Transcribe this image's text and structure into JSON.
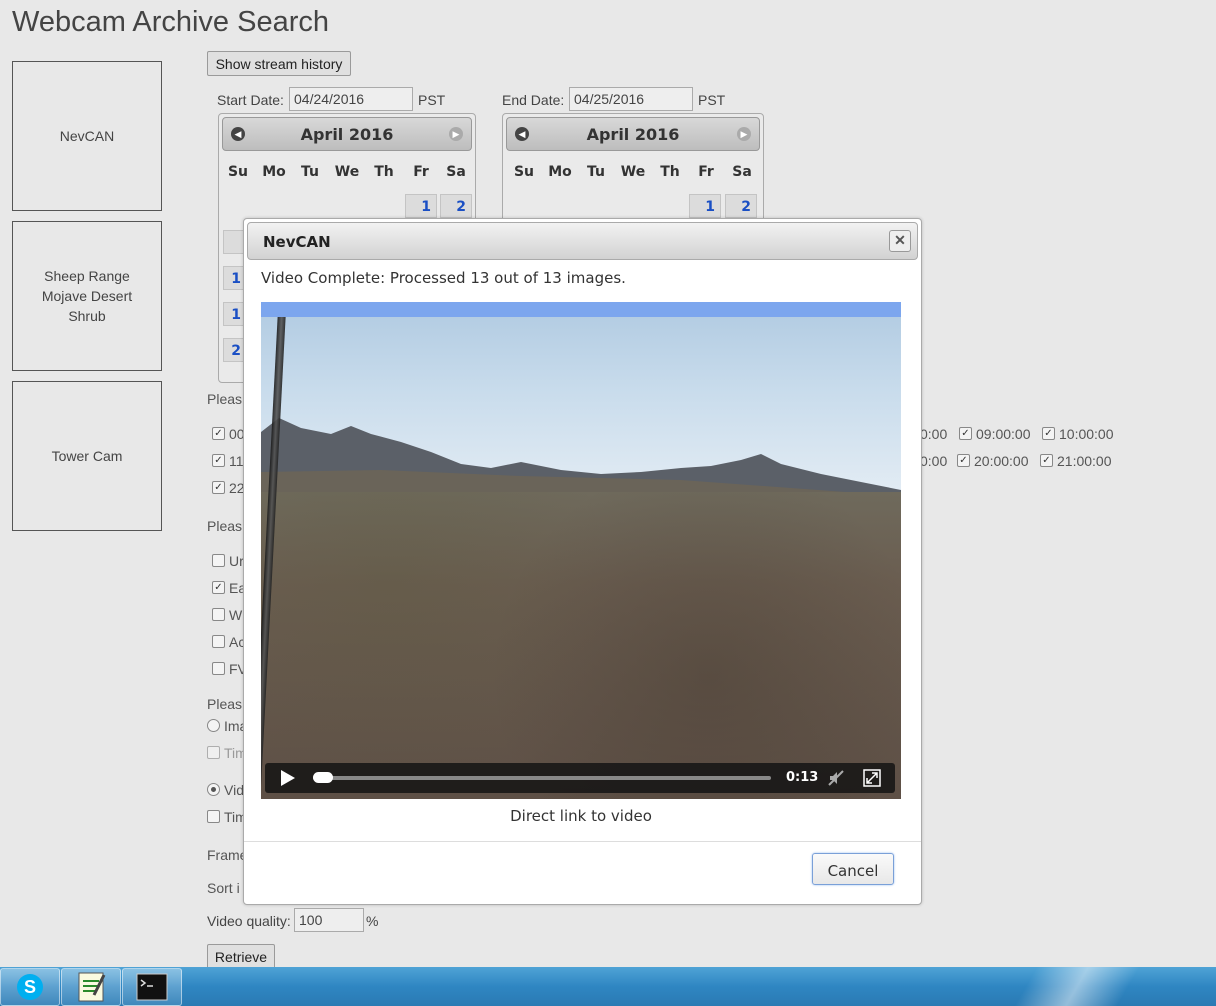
{
  "page": {
    "title": "Webcam Archive Search"
  },
  "stations": [
    {
      "name": "NevCAN"
    },
    {
      "name": "Sheep Range\nMojave Desert\nShrub"
    },
    {
      "name": "Tower Cam"
    }
  ],
  "toolbar": {
    "show_history_label": "Show stream history"
  },
  "start_date": {
    "label": "Start Date:",
    "value": "04/24/2016",
    "tz": "PST"
  },
  "end_date": {
    "label": "End Date:",
    "value": "04/25/2016",
    "tz": "PST"
  },
  "calendars": [
    {
      "month": "April 2016",
      "days_of_week": [
        "Su",
        "Mo",
        "Tu",
        "We",
        "Th",
        "Fr",
        "Sa"
      ],
      "first_row": [
        "1",
        "2"
      ]
    },
    {
      "month": "April 2016",
      "days_of_week": [
        "Su",
        "Mo",
        "Tu",
        "We",
        "Th",
        "Fr",
        "Sa"
      ],
      "first_row": [
        "1",
        "2"
      ]
    }
  ],
  "calendar_partial_days": [
    "1",
    "1",
    "2"
  ],
  "truncated_labels": {
    "please1": "Pleas",
    "please2": "Pleas",
    "please3": "Pleas",
    "time00": "00",
    "time11": "11",
    "time22": "22",
    "opt_un": "Ur",
    "opt_ea": "Ea",
    "opt_w": "W",
    "opt_ac": "Ac",
    "opt_fv": "FV",
    "ima": "Ima",
    "tim1": "Tim",
    "vid": "Vid",
    "tim2": "Tim",
    "frame": "Frame",
    "sort": "Sort i"
  },
  "times_row1": [
    {
      "label": "0:00"
    },
    {
      "label": "09:00:00"
    },
    {
      "label": "10:00:00"
    }
  ],
  "times_row2": [
    {
      "label": "0:00"
    },
    {
      "label": "20:00:00"
    },
    {
      "label": "21:00:00"
    }
  ],
  "video_quality": {
    "label": "Video quality:",
    "value": "100",
    "unit": "%"
  },
  "retrieve_label": "Retrieve",
  "dialog": {
    "title": "NevCAN",
    "close_icon": "close-icon",
    "status": "Video Complete: Processed 13 out of 13 images.",
    "progress_fraction": 1.0,
    "player": {
      "time": "0:13",
      "position_fraction": 0.0
    },
    "direct_link": "Direct link to video",
    "cancel_label": "Cancel"
  },
  "taskbar": {
    "apps": [
      "skype-icon",
      "notepad-icon",
      "cmd-icon"
    ]
  }
}
